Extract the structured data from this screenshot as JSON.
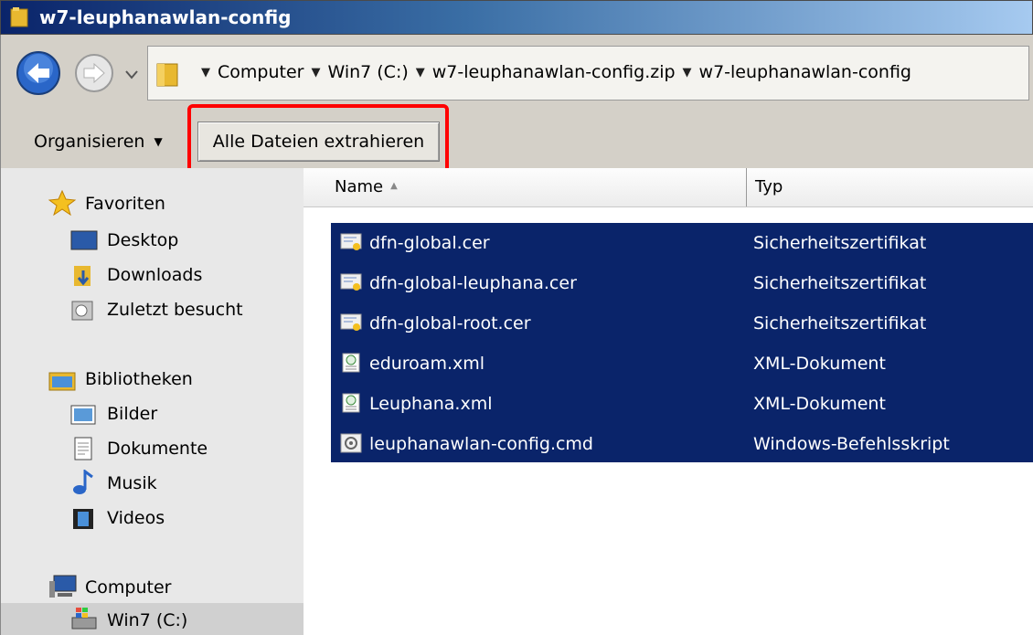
{
  "window": {
    "title": "w7-leuphanawlan-config"
  },
  "address": {
    "crumbs": [
      "Computer",
      "Win7 (C:)",
      "w7-leuphanawlan-config.zip",
      "w7-leuphanawlan-config"
    ]
  },
  "toolbar": {
    "organize_label": "Organisieren",
    "extract_label": "Alle Dateien extrahieren"
  },
  "nav": {
    "favorites": {
      "label": "Favoriten",
      "icon": "star-icon"
    },
    "desktop": {
      "label": "Desktop",
      "icon": "desktop-icon"
    },
    "downloads": {
      "label": "Downloads",
      "icon": "downloads-folder-icon"
    },
    "recent": {
      "label": "Zuletzt besucht",
      "icon": "recent-places-icon"
    },
    "libraries": {
      "label": "Bibliotheken",
      "icon": "libraries-icon"
    },
    "pictures": {
      "label": "Bilder",
      "icon": "pictures-icon"
    },
    "documents": {
      "label": "Dokumente",
      "icon": "documents-icon"
    },
    "music": {
      "label": "Musik",
      "icon": "music-note-icon"
    },
    "videos": {
      "label": "Videos",
      "icon": "video-film-icon"
    },
    "computer": {
      "label": "Computer",
      "icon": "computer-icon"
    },
    "drive": {
      "label": "Win7 (C:)",
      "icon": "drive-icon"
    }
  },
  "columns": {
    "name": "Name",
    "type": "Typ"
  },
  "files": [
    {
      "name": "dfn-global.cer",
      "type": "Sicherheitszertifikat",
      "icon": "certificate-icon"
    },
    {
      "name": "dfn-global-leuphana.cer",
      "type": "Sicherheitszertifikat",
      "icon": "certificate-icon"
    },
    {
      "name": "dfn-global-root.cer",
      "type": "Sicherheitszertifikat",
      "icon": "certificate-icon"
    },
    {
      "name": "eduroam.xml",
      "type": "XML-Dokument",
      "icon": "xml-document-icon"
    },
    {
      "name": "Leuphana.xml",
      "type": "XML-Dokument",
      "icon": "xml-document-icon"
    },
    {
      "name": "leuphanawlan-config.cmd",
      "type": "Windows-Befehlsskript",
      "icon": "script-icon"
    }
  ],
  "colors": {
    "selection": "#0a246a",
    "highlight": "#ff0000"
  }
}
